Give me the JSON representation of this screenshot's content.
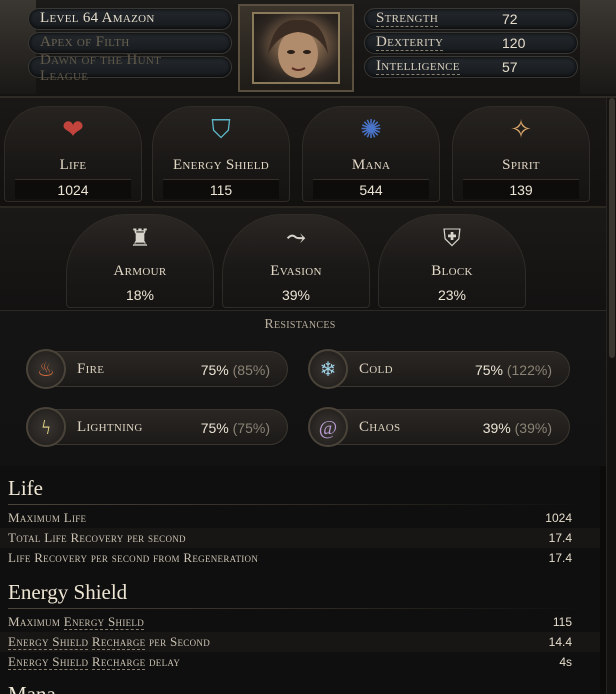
{
  "header": {
    "level_class": "Level 64 Amazon",
    "name": "Apex of Filth",
    "league": "Dawn of the Hunt League",
    "attributes": [
      {
        "label": "Strength",
        "value": "72"
      },
      {
        "label": "Dexterity",
        "value": "120"
      },
      {
        "label": "Intelligence",
        "value": "57"
      }
    ]
  },
  "primary": [
    {
      "label": "Life",
      "value": "1024",
      "icon": "heart-icon",
      "color": "#c2443c"
    },
    {
      "label": "Energy Shield",
      "value": "115",
      "icon": "energy-shield-icon",
      "color": "#5fb8c9"
    },
    {
      "label": "Mana",
      "value": "544",
      "icon": "mana-icon",
      "color": "#4a74c8"
    },
    {
      "label": "Spirit",
      "value": "139",
      "icon": "spirit-icon",
      "color": "#d9a66a"
    }
  ],
  "defences": [
    {
      "label": "Armour",
      "value": "18%",
      "icon": "armour-icon"
    },
    {
      "label": "Evasion",
      "value": "39%",
      "icon": "evasion-icon"
    },
    {
      "label": "Block",
      "value": "23%",
      "icon": "block-shield-icon"
    }
  ],
  "resistances": {
    "title": "Resistances",
    "items": [
      {
        "label": "Fire",
        "value": "75%",
        "max": "(85%)",
        "icon": "fire-icon"
      },
      {
        "label": "Cold",
        "value": "75%",
        "max": "(122%)",
        "icon": "cold-icon"
      },
      {
        "label": "Lightning",
        "value": "75%",
        "max": "(75%)",
        "icon": "lightning-icon"
      },
      {
        "label": "Chaos",
        "value": "39%",
        "max": "(39%)",
        "icon": "chaos-icon"
      }
    ]
  },
  "stats": {
    "life_title": "Life",
    "life_rows": [
      {
        "label": "Maximum Life",
        "value": "1024"
      },
      {
        "label": "Total Life Recovery per second",
        "value": "17.4"
      },
      {
        "label": "Life Recovery per second from Regeneration",
        "value": "17.4"
      }
    ],
    "es_title": "Energy Shield",
    "es_rows": [
      {
        "pre": "Maximum ",
        "u1": "Energy Shield",
        "mid": "",
        "u2": "",
        "post": "",
        "value": "115"
      },
      {
        "pre": "",
        "u1": "Energy Shield",
        "mid": " ",
        "u2": "Recharge",
        "post": " per Second",
        "value": "14.4"
      },
      {
        "pre": "",
        "u1": "Energy Shield",
        "mid": " ",
        "u2": "Recharge",
        "post": " delay",
        "value": "4s"
      }
    ],
    "next_title": "Mana"
  }
}
